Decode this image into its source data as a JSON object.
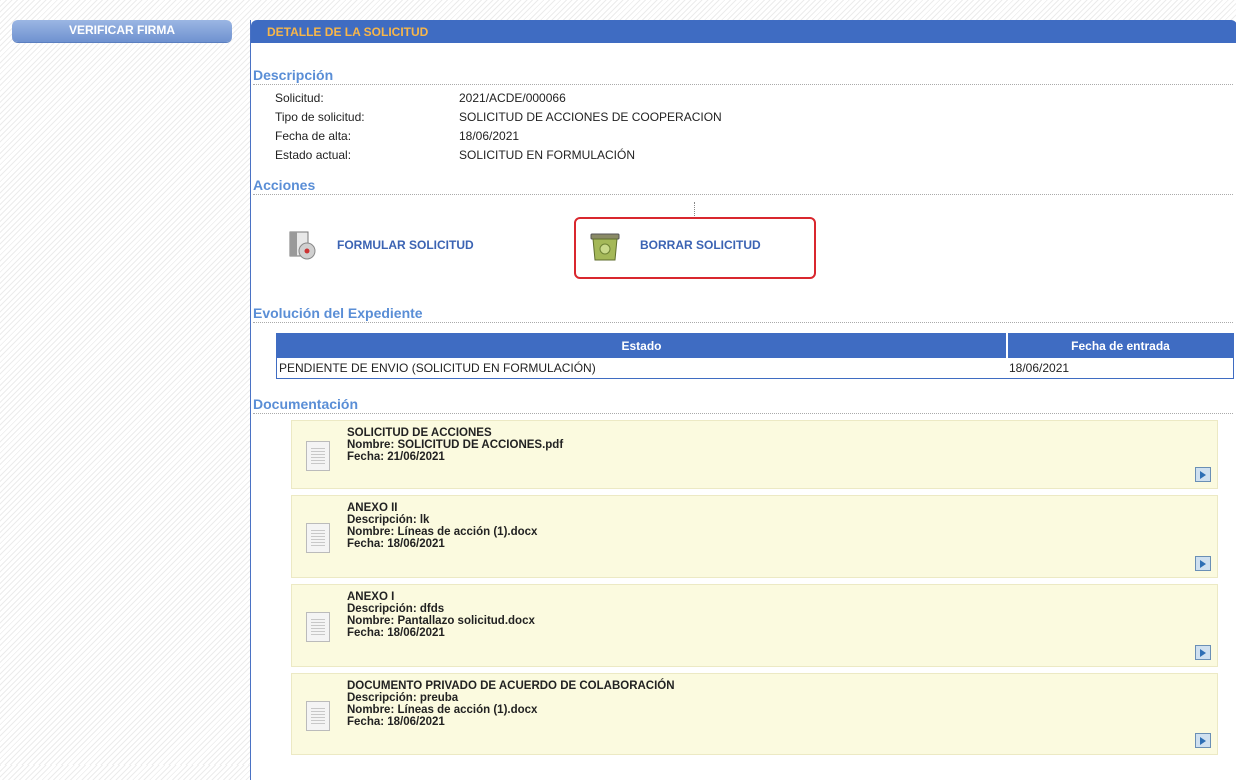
{
  "sidebar": {
    "verify_label": "VERIFICAR FIRMA"
  },
  "header": {
    "title": "DETALLE DE LA SOLICITUD"
  },
  "descripcion": {
    "title": "Descripción",
    "rows": [
      {
        "label": "Solicitud:",
        "value": "2021/ACDE/000066"
      },
      {
        "label": "Tipo de solicitud:",
        "value": "SOLICITUD DE ACCIONES DE COOPERACION"
      },
      {
        "label": "Fecha de alta:",
        "value": "18/06/2021"
      },
      {
        "label": "Estado actual:",
        "value": "SOLICITUD EN FORMULACIÓN"
      }
    ]
  },
  "acciones": {
    "title": "Acciones",
    "formular_label": "FORMULAR SOLICITUD",
    "borrar_label": "BORRAR SOLICITUD"
  },
  "evolucion": {
    "title": "Evolución del Expediente",
    "columns": [
      "Estado",
      "Fecha de entrada"
    ],
    "rows": [
      {
        "estado": "PENDIENTE DE ENVIO (SOLICITUD EN FORMULACIÓN)",
        "fecha": "18/06/2021"
      }
    ]
  },
  "documentacion": {
    "title": "Documentación",
    "docs": [
      {
        "lines": [
          "SOLICITUD DE ACCIONES",
          "Nombre: SOLICITUD DE ACCIONES.pdf",
          "Fecha: 21/06/2021"
        ]
      },
      {
        "lines": [
          "ANEXO II",
          "Descripción: lk",
          "Nombre: Líneas de acción (1).docx",
          "Fecha: 18/06/2021"
        ]
      },
      {
        "lines": [
          "ANEXO I",
          "Descripción: dfds",
          "Nombre: Pantallazo solicitud.docx",
          "Fecha: 18/06/2021"
        ]
      },
      {
        "lines": [
          "DOCUMENTO PRIVADO DE ACUERDO DE COLABORACIÓN",
          "Descripción: preuba",
          "Nombre: Líneas de acción (1).docx",
          "Fecha: 18/06/2021"
        ]
      }
    ]
  },
  "colors": {
    "accent": "#3f6cc2",
    "header_text": "#f7b64a",
    "section_title": "#5a8ed6",
    "highlight": "#d9272e",
    "doc_bg": "#fbfadf"
  }
}
